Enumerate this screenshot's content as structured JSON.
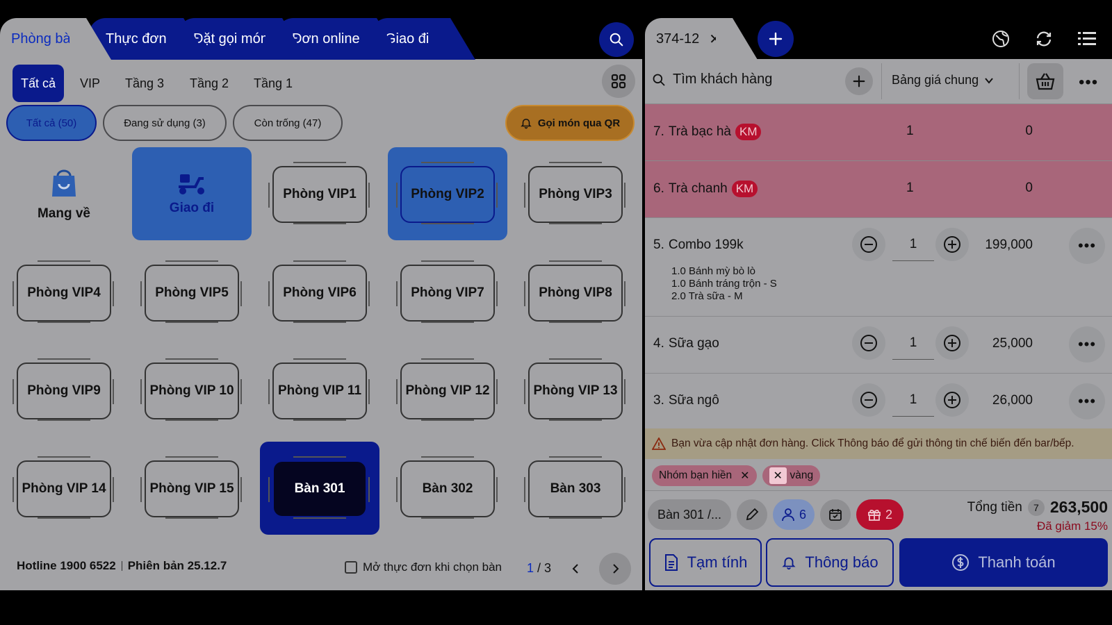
{
  "left": {
    "tabs": [
      "Phòng bàn",
      "Thực đơn",
      "Đặt gọi món",
      "Đơn online",
      "Giao đi"
    ],
    "areas": [
      "Tất cả",
      "VIP",
      "Tầng 3",
      "Tầng 2",
      "Tầng 1"
    ],
    "filters": [
      "Tất cả (50)",
      "Đang sử dụng (3)",
      "Còn trống (47)"
    ],
    "qr_button": "Gọi món qua QR",
    "takeaway": "Mang về",
    "delivery": "Giao đi",
    "rooms": [
      "Phòng VIP1",
      "Phòng VIP2",
      "Phòng VIP3",
      "Phòng VIP4",
      "Phòng VIP5",
      "Phòng VIP6",
      "Phòng VIP7",
      "Phòng VIP8",
      "Phòng VIP9",
      "Phòng VIP 10",
      "Phòng VIP 11",
      "Phòng VIP 12",
      "Phòng VIP 13",
      "Phòng VIP 14",
      "Phòng VIP 15",
      "Bàn 301",
      "Bàn 302",
      "Bàn 303"
    ],
    "hotline": "Hotline 1900 6522",
    "version": "Phiên bản 25.12.7",
    "open_menu_label": "Mở thực đơn khi chọn bàn",
    "page_current": "1",
    "page_total": "/ 3"
  },
  "right": {
    "order_tab": "374-12",
    "customer_search_placeholder": "Tìm khách hàng",
    "pricelist": "Bảng giá chung",
    "km_badge": "KM",
    "lines": [
      {
        "index": "7.",
        "name": "Trà bạc hà",
        "qty": "1",
        "price": "0"
      },
      {
        "index": "6.",
        "name": "Trà chanh",
        "qty": "1",
        "price": "0"
      },
      {
        "index": "5.",
        "name": "Combo 199k",
        "qty": "1",
        "price": "199,000",
        "subs": [
          "1.0 Bánh mỳ bò lò",
          "1.0 Bánh tráng trộn - S",
          "2.0 Trà sữa - M"
        ]
      },
      {
        "index": "4.",
        "name": "Sữa gạo",
        "qty": "1",
        "price": "25,000"
      },
      {
        "index": "3.",
        "name": "Sữa ngô",
        "qty": "1",
        "price": "26,000"
      }
    ],
    "alert": "Bạn vừa cập nhật đơn hàng. Click Thông báo để gửi thông tin chế biến đến bar/bếp.",
    "tags": [
      "Nhóm bạn hiền",
      "Giờ vàng"
    ],
    "table_label": "Bàn 301 /...",
    "guests": "6",
    "gifts": "2",
    "total_label": "Tổng tiền",
    "total_count": "7",
    "total_value": "263,500",
    "discount": "Đã giảm 15%",
    "btn_temp": "Tạm tính",
    "btn_notify": "Thông báo",
    "btn_pay": "Thanh toán"
  },
  "colors": {
    "navy": "#0a1a8c",
    "panel": "#a3a3a6",
    "promo_row": "#a8667a",
    "badge_red": "#b7102e"
  }
}
